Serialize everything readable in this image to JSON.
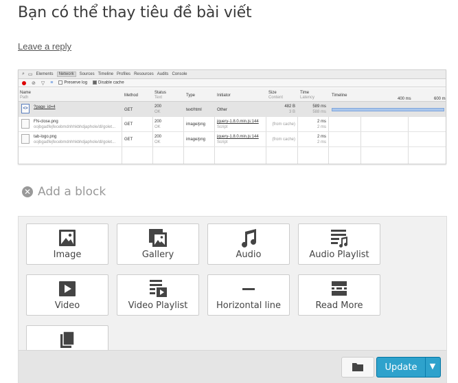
{
  "post": {
    "title": "Bạn có thể thay tiêu đề bài viết",
    "reply_link": "Leave a reply"
  },
  "devtools": {
    "tabs": [
      "Elements",
      "Network",
      "Sources",
      "Timeline",
      "Profiles",
      "Resources",
      "Audits",
      "Console"
    ],
    "active_tab": "Network",
    "toolbar": {
      "preserve_log": "Preserve log",
      "disable_cache": "Disable cache"
    },
    "columns": {
      "name": "Name",
      "name_sub": "Path",
      "method": "Method",
      "status": "Status",
      "status_sub": "Text",
      "type": "Type",
      "initiator": "Initiator",
      "size": "Size",
      "size_sub": "Content",
      "time": "Time",
      "time_sub": "Latency",
      "timeline": "Timeline",
      "tick_1": "400 ms",
      "tick_2": "600 ms"
    },
    "rows": [
      {
        "name": "?page_id=4",
        "path": "",
        "method": "GET",
        "status": "200",
        "status_text": "OK",
        "type": "text/html",
        "initiator": "Other",
        "initiator_sub": "",
        "size": "482 B",
        "content": "3 B",
        "time": "589 ms",
        "latency": "588 ms",
        "bar_start": 0.0,
        "bar_end": 0.99
      },
      {
        "name": "FN-close.png",
        "path": "oojbgadfejfecebmdnhhkbhdjaphole/dl/golet...",
        "method": "GET",
        "status": "200",
        "status_text": "OK",
        "type": "image/png",
        "initiator": "jquery-1.8.0.min.js:144",
        "initiator_sub": "Script",
        "size": "(from cache)",
        "content": "",
        "time": "2 ms",
        "latency": "2 ms",
        "bar_start": null,
        "bar_end": null
      },
      {
        "name": "tab-logo.png",
        "path": "oojbgadfejfecebmdnhhkbhdjaphole/dl/golet...",
        "method": "GET",
        "status": "200",
        "status_text": "OK",
        "type": "image/png",
        "initiator": "jquery-1.8.0.min.js:144",
        "initiator_sub": "Script",
        "size": "(from cache)",
        "content": "",
        "time": "2 ms",
        "latency": "2 ms",
        "bar_start": null,
        "bar_end": null
      }
    ]
  },
  "add_block": {
    "label": "Add a block",
    "icon": "close-circle-icon"
  },
  "blocks": [
    {
      "label": "Image",
      "icon": "image-icon"
    },
    {
      "label": "Gallery",
      "icon": "gallery-icon"
    },
    {
      "label": "Audio",
      "icon": "music-note-icon"
    },
    {
      "label": "Audio Playlist",
      "icon": "audio-playlist-icon"
    },
    {
      "label": "Video",
      "icon": "video-icon"
    },
    {
      "label": "Video Playlist",
      "icon": "video-playlist-icon"
    },
    {
      "label": "Horizontal line",
      "icon": "horizontal-line-icon"
    },
    {
      "label": "Read More",
      "icon": "read-more-icon"
    },
    {
      "label": "",
      "icon": "pages-icon"
    }
  ],
  "footer": {
    "update_label": "Update",
    "folder_icon": "folder-icon",
    "dropdown_icon": "chevron-down-icon"
  }
}
